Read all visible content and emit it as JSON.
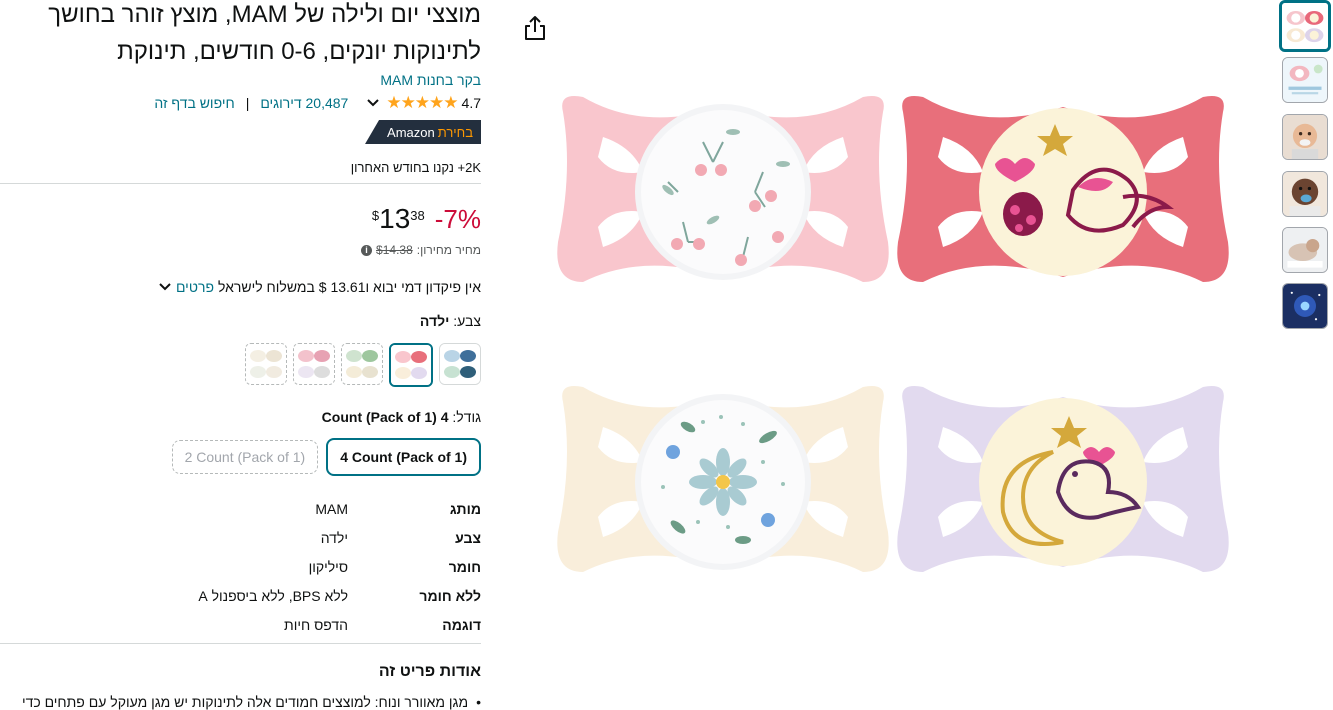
{
  "product": {
    "title": "מוצצי יום ולילה של MAM, מוצץ זוהר בחושך לתינוקות יונקים, 0-6 חודשים, תינוקת",
    "store_link": "בקר בחנות MAM",
    "rating_value": "4.7",
    "stars_display": "★★★★★",
    "ratings_count": "20,487 דירוגים",
    "search_page": "חיפוש בדף זה",
    "separator": "|",
    "badge_prefix": "בחירת",
    "badge_brand": "Amazon",
    "bought_text": "2K+ נקנו בחודש האחרון"
  },
  "pricing": {
    "discount": "-7%",
    "currency": "$",
    "whole": "13",
    "fraction": "38",
    "list_price_label": "מחיר מחירון:",
    "list_price_value": "$14.38",
    "info_icon_glyph": "i",
    "shipping_text": "אין פיקדון דמי יבוא ו13.61 $ במשלוח לישראל",
    "shipping_link": "פרטים"
  },
  "color": {
    "label": "צבע:",
    "selected": "ילדה",
    "options": 5,
    "selected_index": 1
  },
  "size": {
    "label": "גודל:",
    "selected": "4 Count (Pack of 1)",
    "options": [
      "4 Count (Pack of 1)",
      "2 Count (Pack of 1)"
    ]
  },
  "specs": [
    {
      "key": "מותג",
      "value": "MAM"
    },
    {
      "key": "צבע",
      "value": "ילדה"
    },
    {
      "key": "חומר",
      "value": "סיליקון"
    },
    {
      "key": "ללא חומר",
      "value": "ללא BPS, ללא ביספנול A"
    },
    {
      "key": "דוגמה",
      "value": "הדפס חיות"
    }
  ],
  "about": {
    "heading": "אודות פריט זה",
    "bullet_1": "מגן מאוורר ונוח: למוצצים חמודים אלה לתינוקות יש מגן מעוקל עם פתחים כדי"
  },
  "colors": {
    "link": "#007185",
    "discount": "#cc0c39",
    "star": "#ffa41c",
    "badge_bg": "#232f3e",
    "badge_accent": "#ff9900"
  },
  "thumbnails": 6
}
